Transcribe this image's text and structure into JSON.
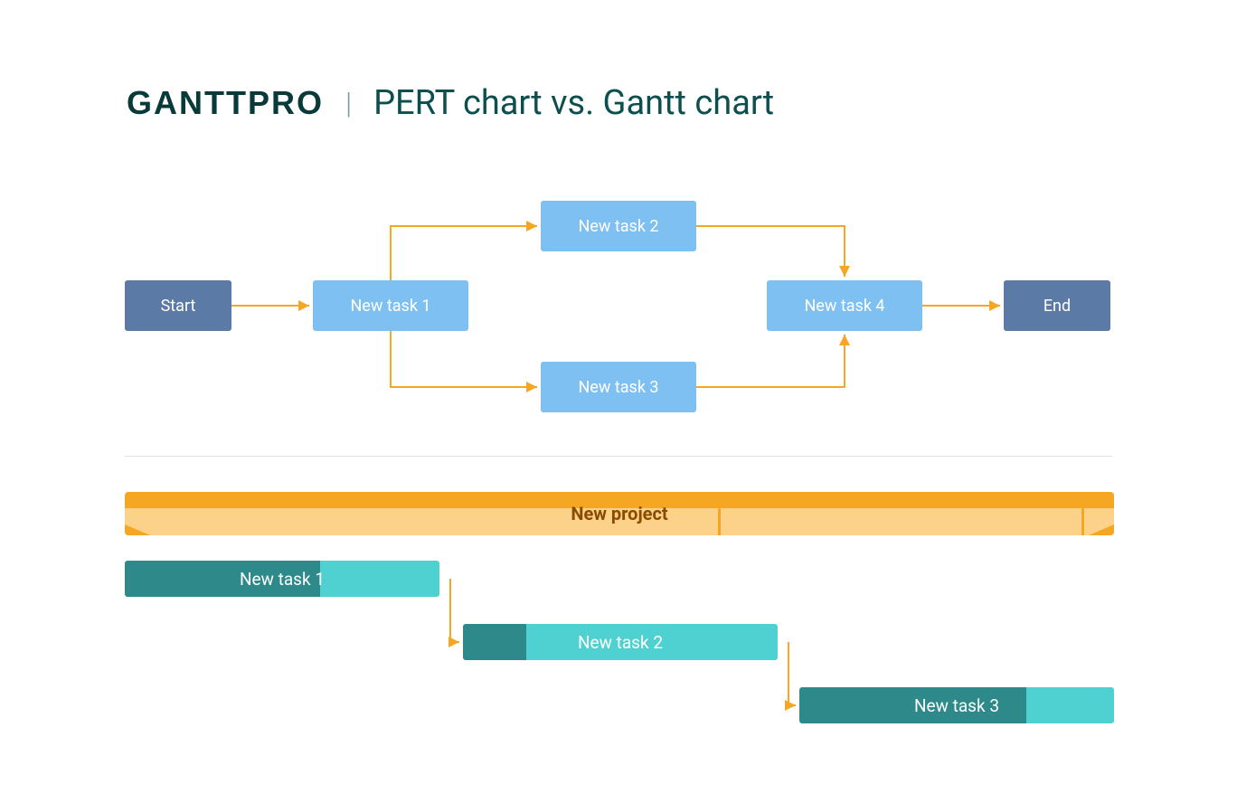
{
  "header": {
    "logo": "GANTTPRO",
    "title": "PERT chart vs. Gantt chart"
  },
  "colors": {
    "arrow": "#f5a623",
    "node_dark": "#5c7aa6",
    "node_light": "#7ec0f2",
    "gantt_progress": "#2e8a8a",
    "gantt_remaining": "#4fd1d1",
    "project_accent": "#f5a623",
    "project_body": "#fcd28a",
    "project_text": "#8a4b00"
  },
  "pert": {
    "nodes": {
      "start": "Start",
      "t1": "New task 1",
      "t2": "New task 2",
      "t3": "New task 3",
      "t4": "New task 4",
      "end": "End"
    },
    "edges": [
      [
        "start",
        "t1"
      ],
      [
        "t1",
        "t2"
      ],
      [
        "t1",
        "t3"
      ],
      [
        "t2",
        "t4"
      ],
      [
        "t3",
        "t4"
      ],
      [
        "t4",
        "end"
      ]
    ]
  },
  "gantt": {
    "project_label": "New project",
    "bars": [
      {
        "label": "New task 1",
        "progress_pct": 62
      },
      {
        "label": "New task 2",
        "progress_pct": 20
      },
      {
        "label": "New task 3",
        "progress_pct": 72
      }
    ],
    "dependencies": [
      [
        "b1",
        "b2"
      ],
      [
        "b2",
        "b3"
      ]
    ]
  }
}
